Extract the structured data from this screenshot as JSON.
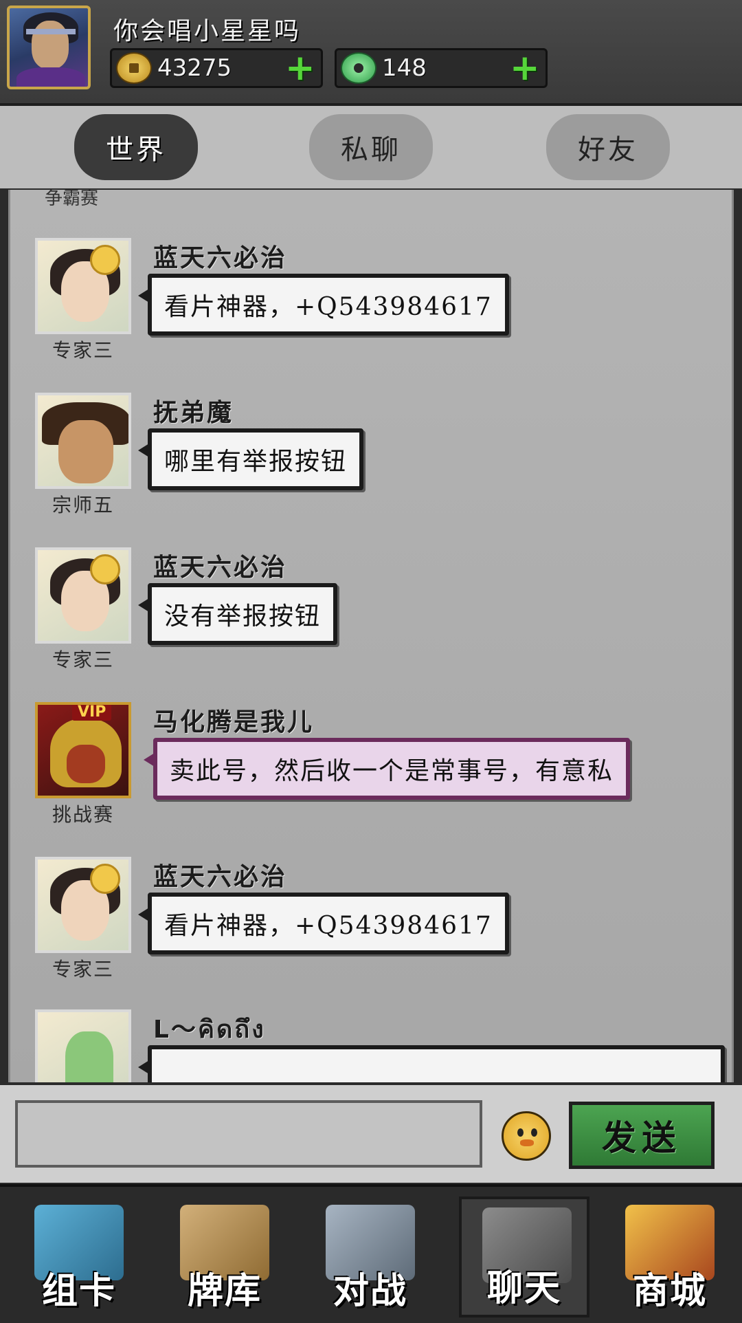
{
  "header": {
    "player_name": "你会唱小星星吗",
    "gold": "43275",
    "jade": "148",
    "plus_symbol": "+"
  },
  "tabs": [
    {
      "label": "世界",
      "active": true
    },
    {
      "label": "私聊",
      "active": false
    },
    {
      "label": "好友",
      "active": false
    }
  ],
  "chat": {
    "top_fragment": "争霸赛",
    "messages": [
      {
        "sender": "蓝天六必治",
        "rank": "专家三",
        "text": "看片神器，+Q543984617",
        "vip": false
      },
      {
        "sender": "抚弟魔",
        "rank": "宗师五",
        "text": "哪里有举报按钮",
        "vip": false
      },
      {
        "sender": "蓝天六必治",
        "rank": "专家三",
        "text": "没有举报按钮",
        "vip": false
      },
      {
        "sender": "马化腾是我儿",
        "rank": "挑战赛",
        "text": "卖此号，然后收一个是常事号，有意私",
        "vip": true,
        "vip_label": "VIP"
      },
      {
        "sender": "蓝天六必治",
        "rank": "专家三",
        "text": "看片神器，+Q543984617",
        "vip": false
      },
      {
        "sender": "L～คิดถึง",
        "rank": "",
        "text": "",
        "vip": false
      }
    ]
  },
  "input": {
    "placeholder": "",
    "send_label": "发送"
  },
  "nav": [
    {
      "label": "组卡",
      "icon": "cards-icon",
      "active": false
    },
    {
      "label": "牌库",
      "icon": "deck-icon",
      "active": false
    },
    {
      "label": "对战",
      "icon": "crossed-swords-icon",
      "active": false
    },
    {
      "label": "聊天",
      "icon": "chat-icon",
      "active": true
    },
    {
      "label": "商城",
      "icon": "shop-icon",
      "active": false
    }
  ],
  "colors": {
    "accent_green": "#56d63a",
    "send_button": "#3c8f42",
    "vip_bubble": "#e9d5ea"
  }
}
